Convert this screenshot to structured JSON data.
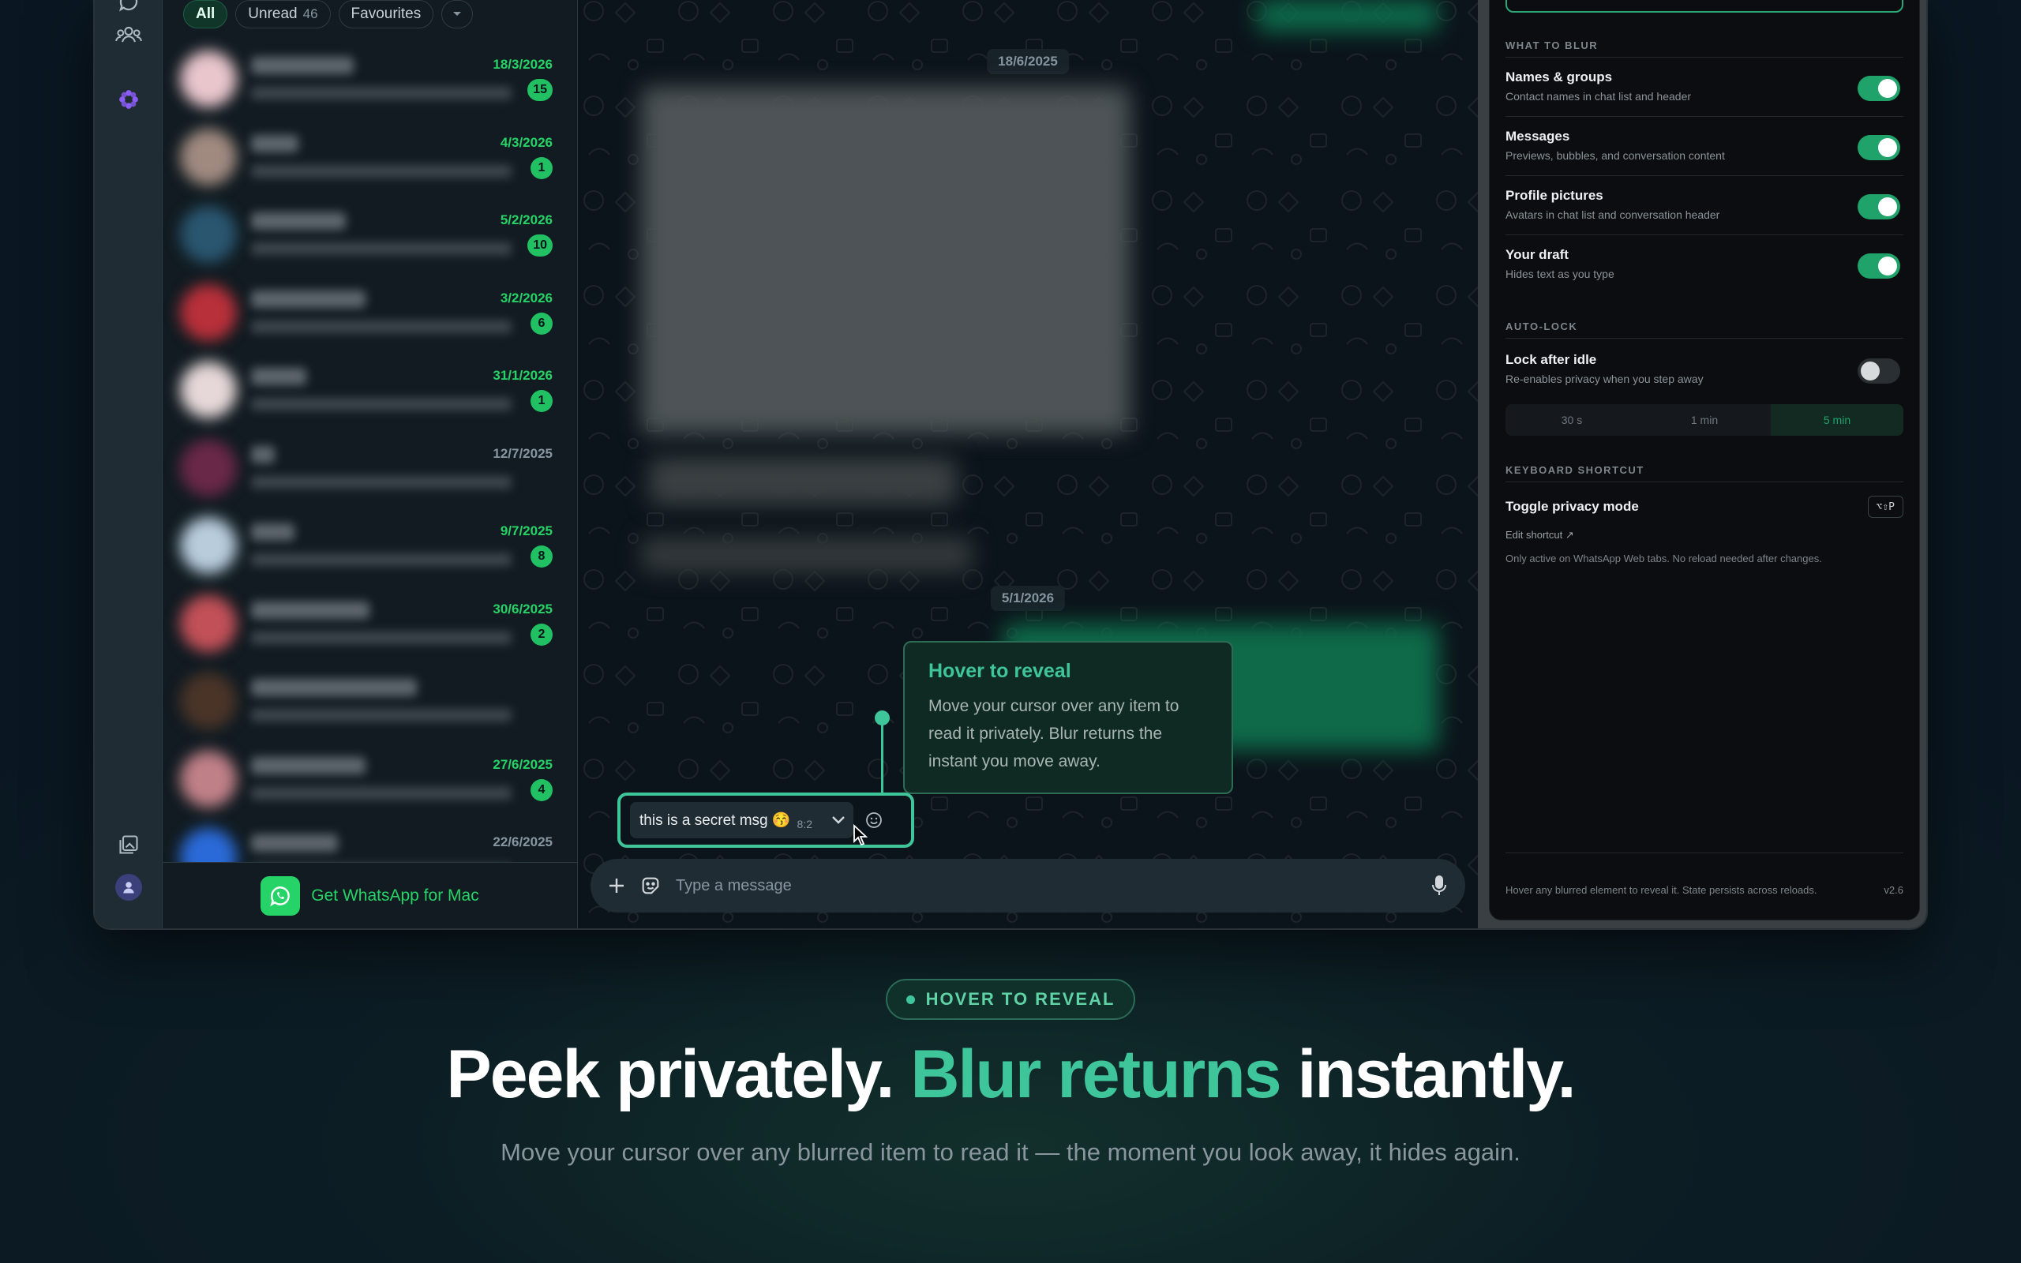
{
  "filters": [
    {
      "label": "All",
      "count": ""
    },
    {
      "label": "Unread",
      "count": "46"
    },
    {
      "label": "Favourites",
      "count": ""
    }
  ],
  "chats": [
    {
      "date": "18/3/2026",
      "unread": "15",
      "avatar": "#e8c6cc"
    },
    {
      "date": "4/3/2026",
      "unread": "1",
      "avatar": "#a08a80"
    },
    {
      "date": "5/2/2026",
      "unread": "10",
      "avatar": "#2a5670"
    },
    {
      "date": "3/2/2026",
      "unread": "6",
      "avatar": "#b8303a"
    },
    {
      "date": "31/1/2026",
      "unread": "1",
      "avatar": "#e6d8d8"
    },
    {
      "date": "12/7/2025",
      "unread": "",
      "avatar": "#6a2848"
    },
    {
      "date": "9/7/2025",
      "unread": "8",
      "avatar": "#b8ccdc"
    },
    {
      "date": "30/6/2025",
      "unread": "2",
      "avatar": "#c25058"
    },
    {
      "date": "",
      "unread": "",
      "avatar": "#4a3428"
    },
    {
      "date": "27/6/2025",
      "unread": "4",
      "avatar": "#c08088"
    },
    {
      "date": "22/6/2025",
      "unread": "",
      "avatar": "#2a6ad8"
    }
  ],
  "get_mac": "Get WhatsApp for Mac",
  "date_separators": [
    "18/6/2025",
    "5/1/2026"
  ],
  "secret_message": {
    "text": "this is a secret msg 😚",
    "time": "8:2"
  },
  "tooltip": {
    "title": "Hover to reveal",
    "body": "Move your cursor over any item to read it privately. Blur returns the instant you move away."
  },
  "composer": {
    "placeholder": "Type a message"
  },
  "panel": {
    "what_to_blur": "WHAT TO BLUR",
    "options": [
      {
        "title": "Names & groups",
        "desc": "Contact names in chat list and header",
        "on": true
      },
      {
        "title": "Messages",
        "desc": "Previews, bubbles, and conversation content",
        "on": true
      },
      {
        "title": "Profile pictures",
        "desc": "Avatars in chat list and conversation header",
        "on": true
      },
      {
        "title": "Your draft",
        "desc": "Hides text as you type",
        "on": true
      }
    ],
    "auto_lock": "AUTO-LOCK",
    "lock": {
      "title": "Lock after idle",
      "desc": "Re-enables privacy when you step away",
      "on": false
    },
    "durations": [
      "30 s",
      "1 min",
      "5 min"
    ],
    "selected_duration": "5 min",
    "keyboard_shortcut": "KEYBOARD SHORTCUT",
    "toggle_label": "Toggle privacy mode",
    "shortcut_keys": "⌥⇧P",
    "edit_shortcut": "Edit shortcut ↗",
    "note": "Only active on WhatsApp Web tabs. No reload needed after changes.",
    "footer": "Hover any blurred element to reveal it. State persists across reloads.",
    "version": "v2.6"
  },
  "hero": {
    "tag": "HOVER TO REVEAL",
    "headline_a": "Peek privately.",
    "headline_accent": "Blur returns",
    "headline_b": "instantly.",
    "subline": "Move your cursor over any blurred item to read it — the moment you look away, it hides again."
  },
  "colors": {
    "accent": "#3fc59a",
    "whatsapp_green": "#25d366",
    "background": "#0a1722"
  }
}
